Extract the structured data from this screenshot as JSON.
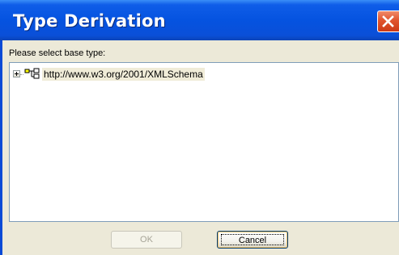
{
  "window": {
    "title": "Type Derivation",
    "close_icon": "close-x-icon",
    "colors": {
      "titlebar": "#0553e0",
      "close_button": "#e0542e",
      "client_background": "#ece9d8"
    }
  },
  "dialog": {
    "prompt": "Please select base type:",
    "tree": {
      "items": [
        {
          "expander_icon": "plus-expander-icon",
          "node_icon": "schema-tree-icon",
          "label": "http://www.w3.org/2001/XMLSchema",
          "expanded": false
        }
      ]
    }
  },
  "buttons": {
    "ok_label": "OK",
    "ok_enabled": false,
    "cancel_label": "Cancel"
  }
}
